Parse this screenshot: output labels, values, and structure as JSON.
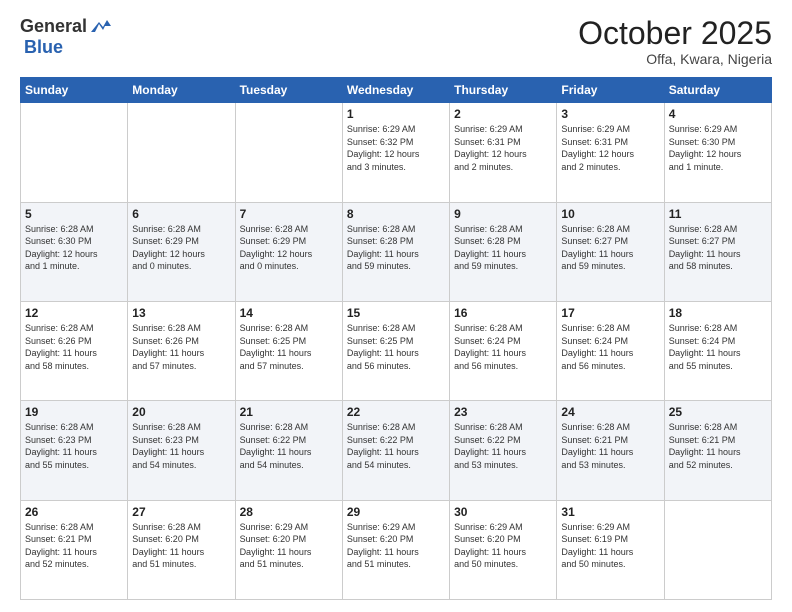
{
  "header": {
    "logo_general": "General",
    "logo_blue": "Blue",
    "month": "October 2025",
    "location": "Offa, Kwara, Nigeria"
  },
  "weekdays": [
    "Sunday",
    "Monday",
    "Tuesday",
    "Wednesday",
    "Thursday",
    "Friday",
    "Saturday"
  ],
  "weeks": [
    [
      {
        "day": "",
        "info": ""
      },
      {
        "day": "",
        "info": ""
      },
      {
        "day": "",
        "info": ""
      },
      {
        "day": "1",
        "info": "Sunrise: 6:29 AM\nSunset: 6:32 PM\nDaylight: 12 hours\nand 3 minutes."
      },
      {
        "day": "2",
        "info": "Sunrise: 6:29 AM\nSunset: 6:31 PM\nDaylight: 12 hours\nand 2 minutes."
      },
      {
        "day": "3",
        "info": "Sunrise: 6:29 AM\nSunset: 6:31 PM\nDaylight: 12 hours\nand 2 minutes."
      },
      {
        "day": "4",
        "info": "Sunrise: 6:29 AM\nSunset: 6:30 PM\nDaylight: 12 hours\nand 1 minute."
      }
    ],
    [
      {
        "day": "5",
        "info": "Sunrise: 6:28 AM\nSunset: 6:30 PM\nDaylight: 12 hours\nand 1 minute."
      },
      {
        "day": "6",
        "info": "Sunrise: 6:28 AM\nSunset: 6:29 PM\nDaylight: 12 hours\nand 0 minutes."
      },
      {
        "day": "7",
        "info": "Sunrise: 6:28 AM\nSunset: 6:29 PM\nDaylight: 12 hours\nand 0 minutes."
      },
      {
        "day": "8",
        "info": "Sunrise: 6:28 AM\nSunset: 6:28 PM\nDaylight: 11 hours\nand 59 minutes."
      },
      {
        "day": "9",
        "info": "Sunrise: 6:28 AM\nSunset: 6:28 PM\nDaylight: 11 hours\nand 59 minutes."
      },
      {
        "day": "10",
        "info": "Sunrise: 6:28 AM\nSunset: 6:27 PM\nDaylight: 11 hours\nand 59 minutes."
      },
      {
        "day": "11",
        "info": "Sunrise: 6:28 AM\nSunset: 6:27 PM\nDaylight: 11 hours\nand 58 minutes."
      }
    ],
    [
      {
        "day": "12",
        "info": "Sunrise: 6:28 AM\nSunset: 6:26 PM\nDaylight: 11 hours\nand 58 minutes."
      },
      {
        "day": "13",
        "info": "Sunrise: 6:28 AM\nSunset: 6:26 PM\nDaylight: 11 hours\nand 57 minutes."
      },
      {
        "day": "14",
        "info": "Sunrise: 6:28 AM\nSunset: 6:25 PM\nDaylight: 11 hours\nand 57 minutes."
      },
      {
        "day": "15",
        "info": "Sunrise: 6:28 AM\nSunset: 6:25 PM\nDaylight: 11 hours\nand 56 minutes."
      },
      {
        "day": "16",
        "info": "Sunrise: 6:28 AM\nSunset: 6:24 PM\nDaylight: 11 hours\nand 56 minutes."
      },
      {
        "day": "17",
        "info": "Sunrise: 6:28 AM\nSunset: 6:24 PM\nDaylight: 11 hours\nand 56 minutes."
      },
      {
        "day": "18",
        "info": "Sunrise: 6:28 AM\nSunset: 6:24 PM\nDaylight: 11 hours\nand 55 minutes."
      }
    ],
    [
      {
        "day": "19",
        "info": "Sunrise: 6:28 AM\nSunset: 6:23 PM\nDaylight: 11 hours\nand 55 minutes."
      },
      {
        "day": "20",
        "info": "Sunrise: 6:28 AM\nSunset: 6:23 PM\nDaylight: 11 hours\nand 54 minutes."
      },
      {
        "day": "21",
        "info": "Sunrise: 6:28 AM\nSunset: 6:22 PM\nDaylight: 11 hours\nand 54 minutes."
      },
      {
        "day": "22",
        "info": "Sunrise: 6:28 AM\nSunset: 6:22 PM\nDaylight: 11 hours\nand 54 minutes."
      },
      {
        "day": "23",
        "info": "Sunrise: 6:28 AM\nSunset: 6:22 PM\nDaylight: 11 hours\nand 53 minutes."
      },
      {
        "day": "24",
        "info": "Sunrise: 6:28 AM\nSunset: 6:21 PM\nDaylight: 11 hours\nand 53 minutes."
      },
      {
        "day": "25",
        "info": "Sunrise: 6:28 AM\nSunset: 6:21 PM\nDaylight: 11 hours\nand 52 minutes."
      }
    ],
    [
      {
        "day": "26",
        "info": "Sunrise: 6:28 AM\nSunset: 6:21 PM\nDaylight: 11 hours\nand 52 minutes."
      },
      {
        "day": "27",
        "info": "Sunrise: 6:28 AM\nSunset: 6:20 PM\nDaylight: 11 hours\nand 51 minutes."
      },
      {
        "day": "28",
        "info": "Sunrise: 6:29 AM\nSunset: 6:20 PM\nDaylight: 11 hours\nand 51 minutes."
      },
      {
        "day": "29",
        "info": "Sunrise: 6:29 AM\nSunset: 6:20 PM\nDaylight: 11 hours\nand 51 minutes."
      },
      {
        "day": "30",
        "info": "Sunrise: 6:29 AM\nSunset: 6:20 PM\nDaylight: 11 hours\nand 50 minutes."
      },
      {
        "day": "31",
        "info": "Sunrise: 6:29 AM\nSunset: 6:19 PM\nDaylight: 11 hours\nand 50 minutes."
      },
      {
        "day": "",
        "info": ""
      }
    ]
  ]
}
